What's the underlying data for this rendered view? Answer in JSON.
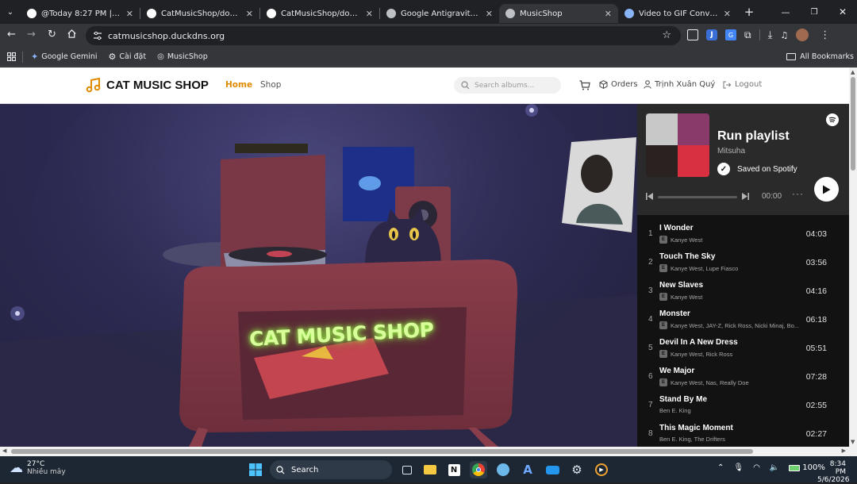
{
  "browser": {
    "tabs": [
      {
        "title": "@Today 8:27 PM | Notion",
        "favicon": "notion-icon",
        "color": "#ffffff"
      },
      {
        "title": "CatMusicShop/docs/api-e",
        "favicon": "github-icon",
        "color": "#ffffff"
      },
      {
        "title": "CatMusicShop/docs/erd-a",
        "favicon": "github-icon",
        "color": "#ffffff"
      },
      {
        "title": "Google Antigravity Auth S",
        "favicon": "globe-icon",
        "color": "#bdc1c6"
      },
      {
        "title": "MusicShop",
        "favicon": "globe-icon",
        "color": "#bdc1c6",
        "active": true
      },
      {
        "title": "Video to GIF Converter - F",
        "favicon": "converter-icon",
        "color": "#8ab4f8"
      }
    ],
    "url": "catmusicshop.duckdns.org",
    "bookmarks": [
      "Google Gemini",
      "Cài đặt",
      "MusicShop"
    ],
    "all_bookmarks": "All Bookmarks"
  },
  "site": {
    "logo": "CAT MUSIC SHOP",
    "nav": {
      "home": "Home",
      "shop": "Shop"
    },
    "search_placeholder": "Search albums...",
    "orders": "Orders",
    "user": "Trịnh Xuân Quý",
    "logout": "Logout",
    "accent": "#e08a00"
  },
  "scene": {
    "neon_sign": "CAT MUSIC SHOP"
  },
  "spotify": {
    "title": "Run playlist",
    "owner": "Mitsuha",
    "saved": "Saved on Spotify",
    "time": "00:00",
    "tracks": [
      {
        "num": "1",
        "name": "I Wonder",
        "artist": "Kanye West",
        "explicit": true,
        "duration": "04:03"
      },
      {
        "num": "2",
        "name": "Touch The Sky",
        "artist": "Kanye West, Lupe Fiasco",
        "explicit": true,
        "duration": "03:56"
      },
      {
        "num": "3",
        "name": "New Slaves",
        "artist": "Kanye West",
        "explicit": true,
        "duration": "04:16"
      },
      {
        "num": "4",
        "name": "Monster",
        "artist": "Kanye West, JAY-Z, Rick Ross, Nicki Minaj, Bo...",
        "explicit": true,
        "duration": "06:18"
      },
      {
        "num": "5",
        "name": "Devil In A New Dress",
        "artist": "Kanye West, Rick Ross",
        "explicit": true,
        "duration": "05:51"
      },
      {
        "num": "6",
        "name": "We Major",
        "artist": "Kanye West, Nas, Really Doe",
        "explicit": true,
        "duration": "07:28"
      },
      {
        "num": "7",
        "name": "Stand By Me",
        "artist": "Ben E. King",
        "explicit": false,
        "duration": "02:55"
      },
      {
        "num": "8",
        "name": "This Magic Moment",
        "artist": "Ben E. King, The Drifters",
        "explicit": false,
        "duration": "02:27"
      }
    ]
  },
  "taskbar": {
    "weather_temp": "27°C",
    "weather_desc": "Nhiều mây",
    "search": "Search",
    "battery": "100%",
    "time": "8:34 PM",
    "date": "5/6/2026"
  }
}
